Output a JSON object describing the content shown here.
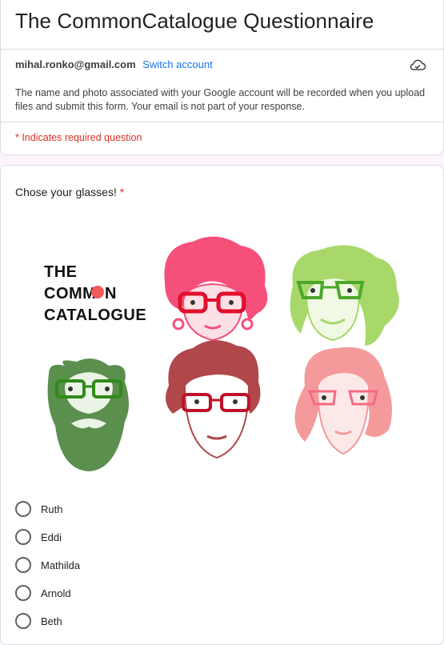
{
  "form": {
    "title": "The CommonCatalogue Questionnaire",
    "email": "mihal.ronko@gmail.com",
    "switch_account": "Switch account",
    "notice": "The name and photo associated with your Google account will be recorded when you upload files and submit this form. Your email is not part of your response.",
    "required_note": "* Indicates required question"
  },
  "question": {
    "title": "Chose your glasses!",
    "required_mark": "*",
    "logo_lines": [
      "THE",
      "COMM",
      "N",
      "CATALOGUE"
    ],
    "options": [
      "Ruth",
      "Eddi",
      "Mathilda",
      "Arnold",
      "Beth"
    ]
  },
  "colors": {
    "accent": "#1a73e8",
    "required": "#d93025",
    "pink_face": "#f4507a",
    "lime_face": "#a8d86a",
    "green_face": "#5a8f4e",
    "brick_face": "#b0474a",
    "salmon_face": "#f59a9a",
    "glasses_red": "#e0102e",
    "glasses_green": "#4aa82a"
  }
}
